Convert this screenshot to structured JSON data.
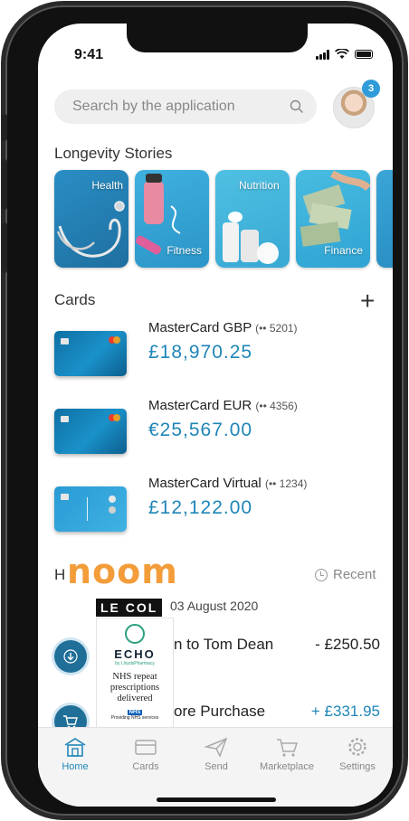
{
  "status": {
    "time": "9:41"
  },
  "search": {
    "placeholder": "Search by the application"
  },
  "profile": {
    "notifications": "3"
  },
  "stories": {
    "title": "Longevity Stories",
    "items": [
      {
        "label": "Health"
      },
      {
        "label": "Fitness"
      },
      {
        "label": "Nutrition"
      },
      {
        "label": "Finance"
      }
    ]
  },
  "cards": {
    "title": "Cards",
    "add_symbol": "+",
    "items": [
      {
        "name": "MasterCard GBP",
        "mask": "(•• 5201)",
        "balance": "£18,970.25"
      },
      {
        "name": "MasterCard EUR",
        "mask": "(•• 4356)",
        "balance": "€25,567.00"
      },
      {
        "name": "MasterCard Virtual",
        "mask": "(•• 1234)",
        "balance": "£12,122.00"
      }
    ]
  },
  "history": {
    "title_initial": "H",
    "recent_label": "Recent",
    "date": "03 August 2020",
    "transactions": [
      {
        "text": "n to Tom Dean",
        "amount": "- £250.50",
        "color": "#222222"
      },
      {
        "text": "ore Purchase",
        "amount": "+ £331.95",
        "color": "#1f86b8"
      }
    ]
  },
  "overlays": {
    "noom": "noom",
    "lecol": "LE COL",
    "echo": {
      "name": "ECHO",
      "sub": "by LloydsPharmacy",
      "message": "NHS repeat prescriptions delivered",
      "nhs_badge": "NHS",
      "nhs_line": "Providing NHS services"
    }
  },
  "tabs": [
    {
      "label": "Home",
      "icon": "home-icon",
      "active": true
    },
    {
      "label": "Cards",
      "icon": "cards-icon",
      "active": false
    },
    {
      "label": "Send",
      "icon": "send-icon",
      "active": false
    },
    {
      "label": "Marketplace",
      "icon": "cart-icon",
      "active": false
    },
    {
      "label": "Settings",
      "icon": "gear-icon",
      "active": false
    }
  ],
  "colors": {
    "accent": "#1f86b8",
    "noom": "#f39c3a"
  }
}
